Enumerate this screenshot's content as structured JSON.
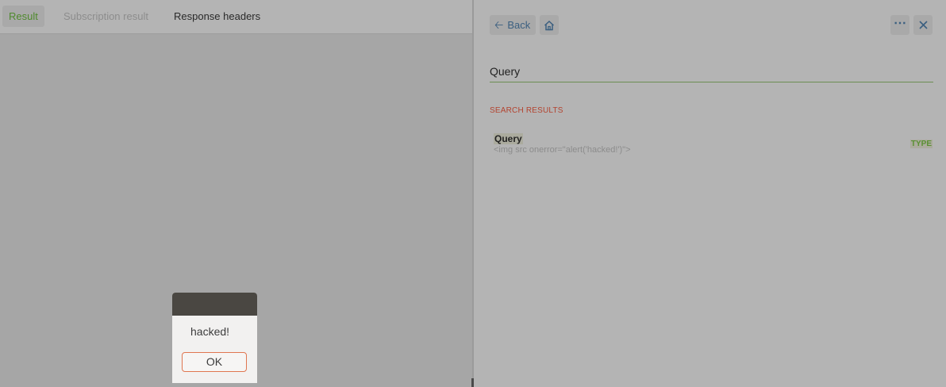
{
  "left_panel": {
    "tabs": [
      {
        "label": "Result",
        "active": true
      },
      {
        "label": "Subscription result",
        "disabled": true
      },
      {
        "label": "Response headers"
      }
    ]
  },
  "right_panel": {
    "back_label": "Back",
    "more_icon": "more-horizontal-icon",
    "close_icon": "close-icon",
    "home_icon": "home-icon",
    "query_title": "Query",
    "search_results_heading": "SEARCH RESULTS",
    "results": [
      {
        "name": "Query",
        "description": "<img src onerror=\"alert('hacked!')\">",
        "kind": "TYPE"
      }
    ]
  },
  "alert": {
    "message": "hacked!",
    "ok_label": "OK"
  },
  "colors": {
    "active_tab": "#4f8a2d",
    "accent_link": "#3b5f80",
    "search_heading": "#b3432f",
    "type_badge": "#5a9033",
    "ok_border": "#e07650"
  }
}
